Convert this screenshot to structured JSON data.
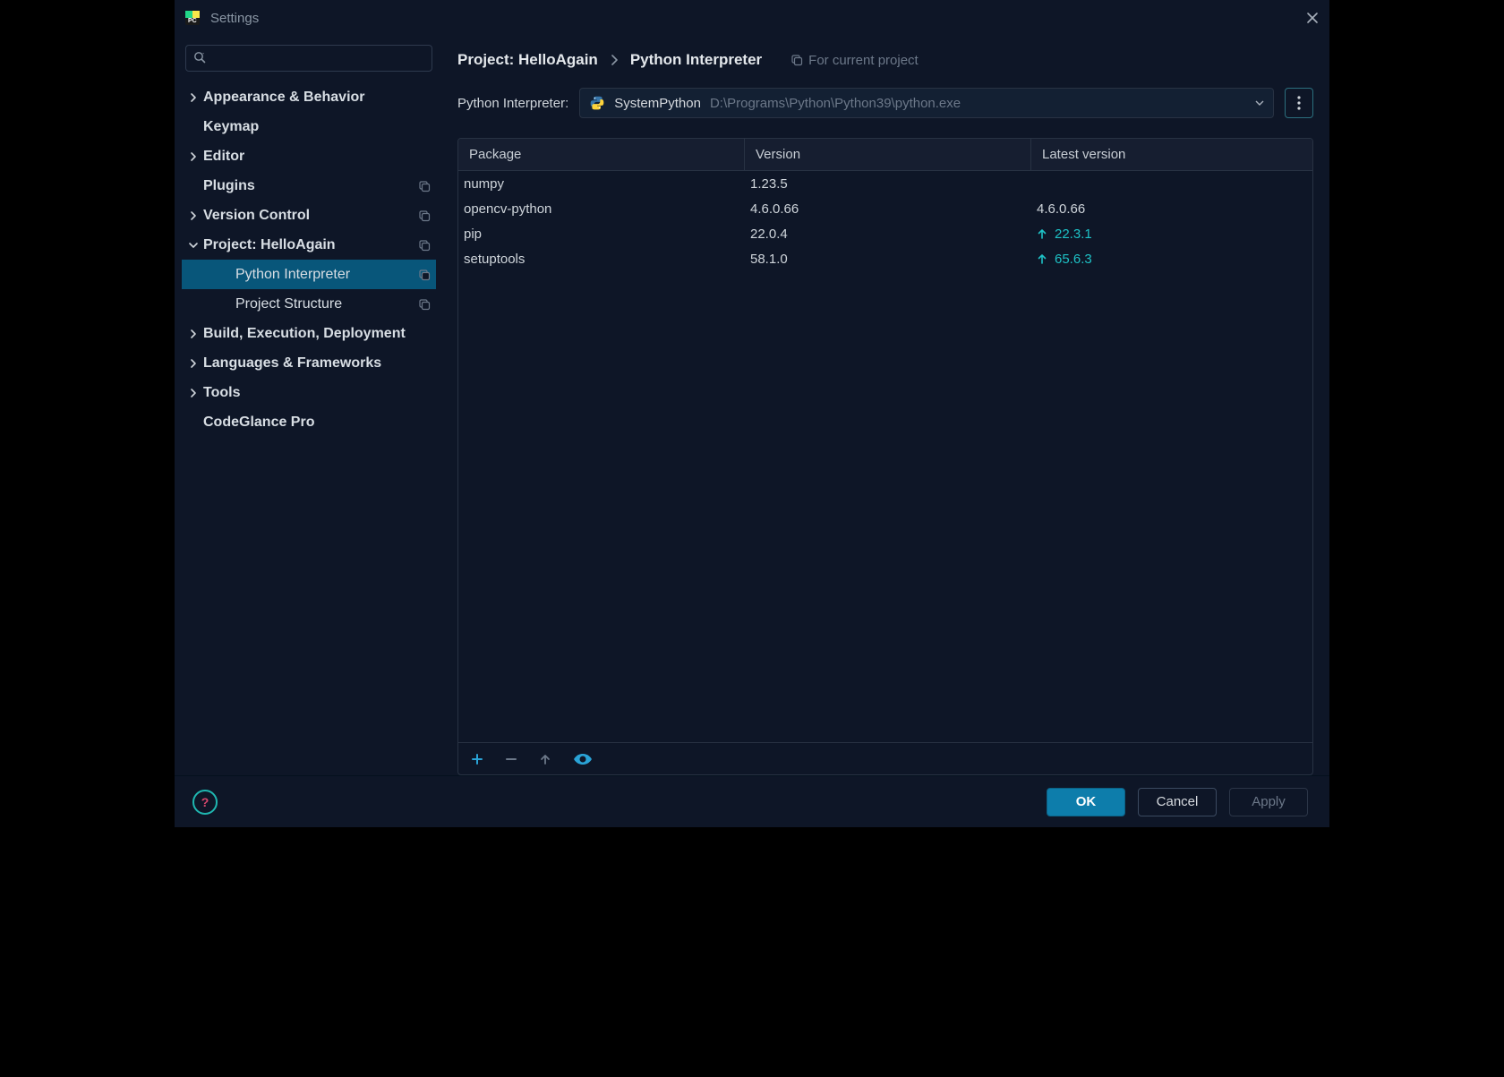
{
  "window": {
    "title": "Settings"
  },
  "search": {
    "placeholder": ""
  },
  "sidebar": [
    {
      "label": "Appearance & Behavior",
      "expandable": true,
      "expanded": false,
      "indent": 0,
      "badge": false
    },
    {
      "label": "Keymap",
      "expandable": false,
      "indent": 0,
      "badge": false
    },
    {
      "label": "Editor",
      "expandable": true,
      "expanded": false,
      "indent": 0,
      "badge": false
    },
    {
      "label": "Plugins",
      "expandable": false,
      "indent": 0,
      "badge": true
    },
    {
      "label": "Version Control",
      "expandable": true,
      "expanded": false,
      "indent": 0,
      "badge": true
    },
    {
      "label": "Project: HelloAgain",
      "expandable": true,
      "expanded": true,
      "indent": 0,
      "badge": true
    },
    {
      "label": "Python Interpreter",
      "expandable": false,
      "indent": 1,
      "badge": true,
      "selected": true
    },
    {
      "label": "Project Structure",
      "expandable": false,
      "indent": 1,
      "badge": true
    },
    {
      "label": "Build, Execution, Deployment",
      "expandable": true,
      "expanded": false,
      "indent": 0,
      "badge": false
    },
    {
      "label": "Languages & Frameworks",
      "expandable": true,
      "expanded": false,
      "indent": 0,
      "badge": false
    },
    {
      "label": "Tools",
      "expandable": true,
      "expanded": false,
      "indent": 0,
      "badge": false
    },
    {
      "label": "CodeGlance Pro",
      "expandable": false,
      "indent": 0,
      "badge": false
    }
  ],
  "breadcrumb": {
    "project": "Project: HelloAgain",
    "page": "Python Interpreter",
    "note": "For current project"
  },
  "interpreter": {
    "label": "Python Interpreter:",
    "name": "SystemPython",
    "path": "D:\\Programs\\Python\\Python39\\python.exe"
  },
  "table": {
    "headers": {
      "package": "Package",
      "version": "Version",
      "latest": "Latest version"
    },
    "rows": [
      {
        "package": "numpy",
        "version": "1.23.5",
        "latest": "",
        "upgrade": false
      },
      {
        "package": "opencv-python",
        "version": "4.6.0.66",
        "latest": "4.6.0.66",
        "upgrade": false
      },
      {
        "package": "pip",
        "version": "22.0.4",
        "latest": "22.3.1",
        "upgrade": true
      },
      {
        "package": "setuptools",
        "version": "58.1.0",
        "latest": "65.6.3",
        "upgrade": true
      }
    ]
  },
  "footer": {
    "ok": "OK",
    "cancel": "Cancel",
    "apply": "Apply",
    "help": "?"
  }
}
